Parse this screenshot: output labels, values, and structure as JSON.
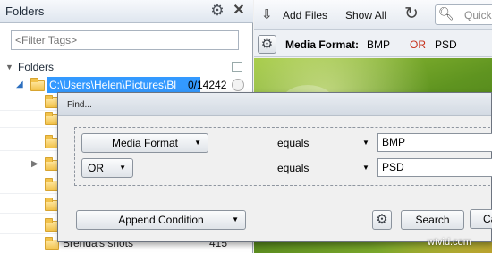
{
  "left_panel": {
    "title": "Folders",
    "filter_placeholder": "<Filter Tags>",
    "section_label": "Folders",
    "selected_folder": {
      "path": "C:\\Users\\Helen\\Pictures\\Bl",
      "count": "0/14242"
    },
    "last_folder": {
      "name": "Brenda's shots",
      "count": "415"
    }
  },
  "toolbar": {
    "add_files_label": "Add Files",
    "show_all_label": "Show All",
    "search_placeholder": "Quick"
  },
  "format_bar": {
    "key": "Media Format:",
    "value1": "BMP",
    "operator": "OR",
    "value2": "PSD",
    "operator_color": "#c6311b"
  },
  "find_dialog": {
    "title": "Find...",
    "conditions": [
      {
        "field": "Media Format",
        "comparison": "equals",
        "value": "BMP"
      },
      {
        "logic": "OR",
        "comparison": "equals",
        "value": "PSD"
      }
    ],
    "append_label": "Append Condition",
    "search_label": "Search",
    "cancel_label": "Ca"
  },
  "watermark": "wtvid.com",
  "icons": {
    "gear": "gear-icon",
    "close": "close-icon",
    "add_files": "add-files-icon",
    "refresh": "refresh-icon",
    "search": "magnifier-icon",
    "folder": "folder-icon"
  },
  "colors": {
    "selection": "#3399ff",
    "folder": "#f2c24a"
  }
}
